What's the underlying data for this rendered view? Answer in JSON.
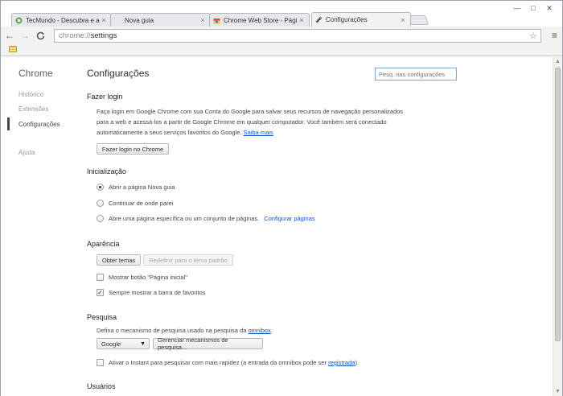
{
  "tabs": [
    {
      "title": "TecMundo - Descubra e a",
      "icon": "tecmundo-favicon"
    },
    {
      "title": "Nova guia",
      "icon": "blank-favicon"
    },
    {
      "title": "Chrome Web Store - Págin",
      "icon": "webstore-favicon"
    },
    {
      "title": "Configurações",
      "icon": "wrench-favicon"
    }
  ],
  "window_controls": {
    "minimize": "—",
    "maximize": "□",
    "close": "✕"
  },
  "toolbar": {
    "url_scheme": "chrome://",
    "url_path": "settings",
    "back": "←",
    "forward": "→",
    "reload": "C",
    "star": "☆",
    "menu": "≡"
  },
  "sidebar": {
    "brand": "Chrome",
    "items": [
      {
        "label": "Histórico"
      },
      {
        "label": "Extensões"
      },
      {
        "label": "Configurações"
      },
      {
        "label": "Ajuda"
      }
    ]
  },
  "main": {
    "title": "Configurações",
    "search_placeholder": "Pesq. nas configurações",
    "login": {
      "heading": "Fazer login",
      "line1": "Faça login em Google Chrome com sua Conta do Google para salvar seus recursos de navegação personalizados",
      "line2": "para a web e acessá-los a partir de Google Chrome em qualquer computador. Você também será conectado",
      "line3": "automaticamente a seus serviços favoritos do Google.",
      "link": "Saiba mais",
      "button": "Fazer login no Chrome"
    },
    "startup": {
      "heading": "Inicialização",
      "options": [
        {
          "label": "Abrir a página Nova guia",
          "selected": true
        },
        {
          "label": "Continuar de onde parei",
          "selected": false
        },
        {
          "label": "Abre uma página específica ou um conjunto de páginas.",
          "selected": false
        }
      ],
      "configure_link": "Configurar páginas"
    },
    "appearance": {
      "heading": "Aparência",
      "get_themes": "Obter temas",
      "reset_theme": "Redefinir para o tema padrão",
      "home_button": "Mostrar botão \"Página inicial\"",
      "home_checked": false,
      "bookmarks_bar": "Sempre mostrar a barra de favoritos",
      "bookmarks_checked": true
    },
    "search": {
      "heading": "Pesquisa",
      "text": "Defina o mecanismo de pesquisa usado na pesquisa da",
      "omnibox_link": "omnibox",
      "text_end": ".",
      "engine": "Google",
      "manage_button": "Gerenciar mecanismos de pesquisa...",
      "instant_pre": "Ativar o Instant para pesquisar com mais rapidez (a entrada da omnibox pode ser",
      "instant_link": "registrada",
      "instant_post": ").",
      "instant_checked": false
    },
    "users": {
      "heading": "Usuários"
    }
  }
}
